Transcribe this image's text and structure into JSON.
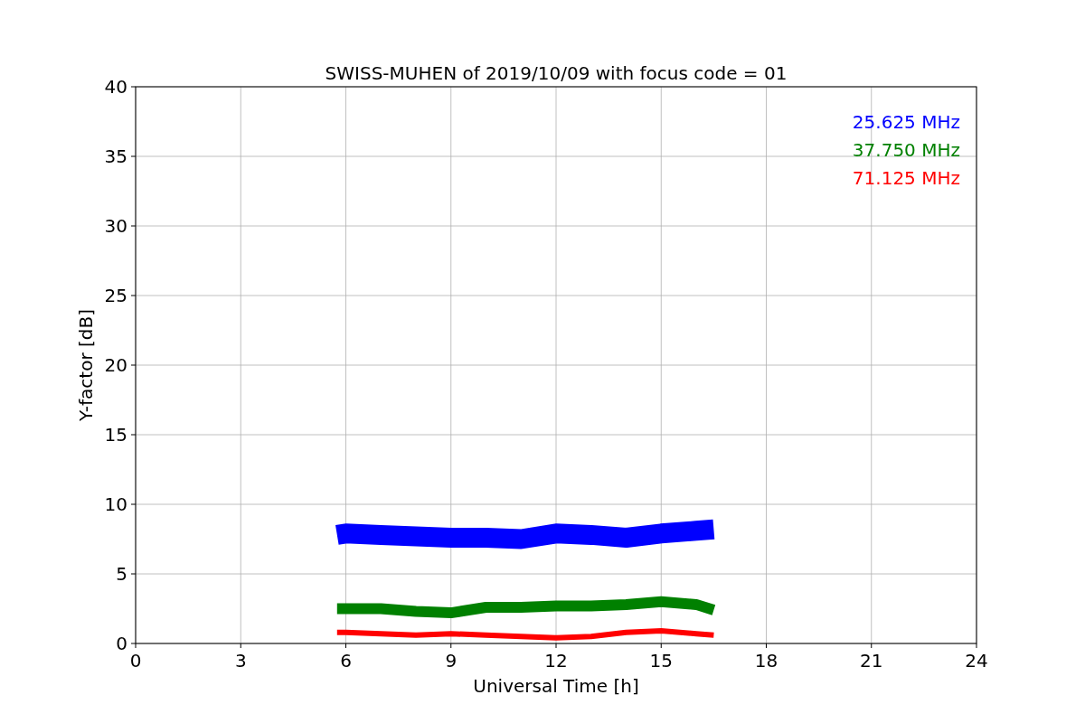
{
  "chart_data": {
    "type": "line",
    "title": "SWISS-MUHEN of 2019/10/09 with focus code = 01",
    "xlabel": "Universal Time [h]",
    "ylabel": "Y-factor [dB]",
    "x": [
      5.75,
      6,
      7,
      8,
      9,
      10,
      11,
      12,
      13,
      14,
      15,
      16,
      16.5
    ],
    "xlim": [
      0,
      24
    ],
    "ylim": [
      0,
      40
    ],
    "xticks": [
      0,
      3,
      6,
      9,
      12,
      15,
      18,
      21,
      24
    ],
    "yticks": [
      0,
      5,
      10,
      15,
      20,
      25,
      30,
      35,
      40
    ],
    "grid": true,
    "series": [
      {
        "name": "25.625 MHz",
        "color": "#0000ff",
        "values": [
          7.8,
          7.9,
          7.8,
          7.7,
          7.6,
          7.6,
          7.5,
          7.9,
          7.8,
          7.6,
          7.9,
          8.1,
          8.2
        ]
      },
      {
        "name": "37.750 MHz",
        "color": "#008000",
        "values": [
          2.5,
          2.5,
          2.5,
          2.3,
          2.2,
          2.6,
          2.6,
          2.7,
          2.7,
          2.8,
          3.0,
          2.8,
          2.4
        ]
      },
      {
        "name": "71.125 MHz",
        "color": "#ff0000",
        "values": [
          0.8,
          0.8,
          0.7,
          0.6,
          0.7,
          0.6,
          0.5,
          0.4,
          0.5,
          0.8,
          0.9,
          0.7,
          0.6
        ]
      }
    ]
  }
}
